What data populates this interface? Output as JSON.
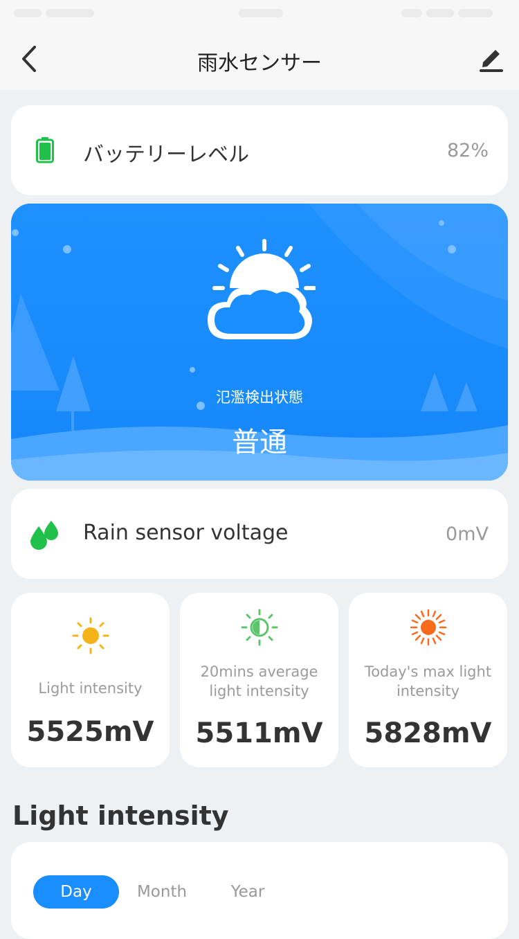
{
  "nav": {
    "title": "雨水センサー",
    "back_icon": "chevron-left-icon",
    "edit_icon": "pencil-icon"
  },
  "battery": {
    "icon": "battery-icon",
    "label": "バッテリーレベル",
    "value": "82%",
    "level": 0.82,
    "color": "#21c04a"
  },
  "weather": {
    "icon": "partly-cloudy-icon",
    "label": "氾濫検出状態",
    "value": "普通",
    "background": "#1a8dff"
  },
  "rain": {
    "icon": "water-drops-icon",
    "label": "Rain sensor voltage",
    "value": "0mV",
    "color": "#21c04a"
  },
  "stats": [
    {
      "icon": "sun-icon",
      "caption": [
        "Light intensity"
      ],
      "value": "5525mV",
      "color": "#f5b31a"
    },
    {
      "icon": "half-sun-icon",
      "caption": [
        "20mins average",
        "light intensity"
      ],
      "value": "5511mV",
      "color": "#5cc46a"
    },
    {
      "icon": "sun-max-icon",
      "caption": [
        "Today's max light",
        "intensity"
      ],
      "value": "5828mV",
      "color": "#f86a1c"
    }
  ],
  "section": {
    "title": "Light intensity"
  },
  "tabs": [
    {
      "label": "Day",
      "active": true
    },
    {
      "label": "Month",
      "active": false
    },
    {
      "label": "Year",
      "active": false
    }
  ]
}
